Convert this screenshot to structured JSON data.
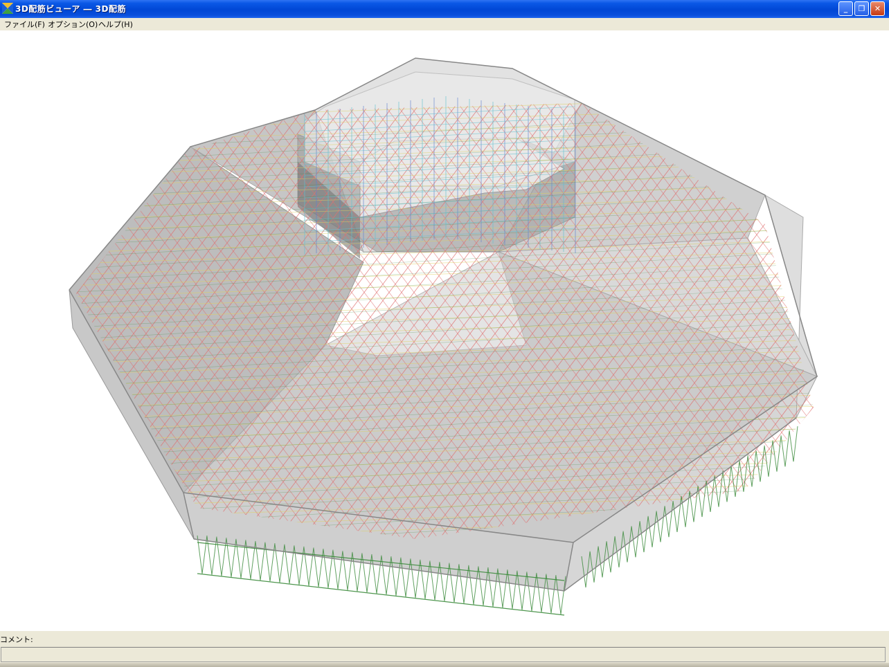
{
  "window": {
    "title": "3D配筋ビューア ― 3D配筋",
    "minimize_glyph": "_",
    "restore_glyph": "❐",
    "close_glyph": "✕"
  },
  "menu": {
    "items": [
      {
        "label": "ファイル(F)"
      },
      {
        "label": "オプション(O)"
      },
      {
        "label": "ヘルプ(H)"
      }
    ]
  },
  "footer": {
    "comment_label": "コメント:",
    "comment_value": ""
  },
  "colors": {
    "titlebar": "#0047d5",
    "rebar_red": "#e07070",
    "rebar_green": "#3a8a3a",
    "rebar_yellow": "#e0d060",
    "rebar_blue": "#6080d0",
    "rebar_cyan": "#60c0d0"
  }
}
